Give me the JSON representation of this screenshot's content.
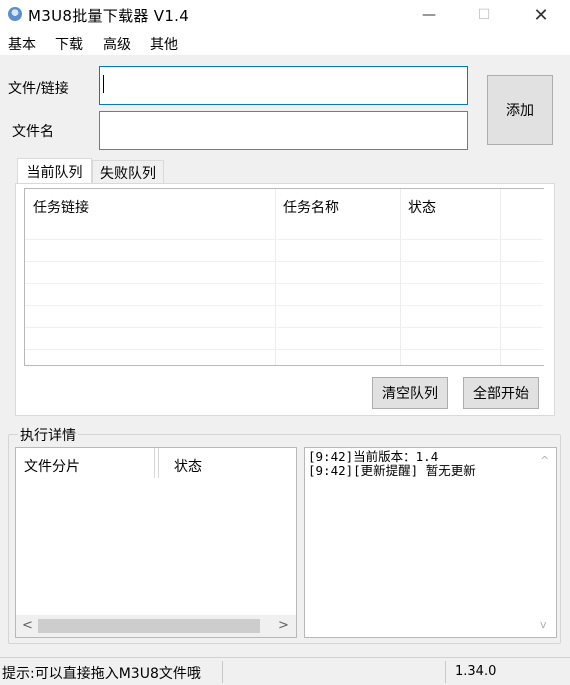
{
  "window": {
    "title": "M3U8批量下载器  V1.4",
    "minimize_glyph": "—",
    "maximize_glyph": "☐",
    "close_glyph": "✕"
  },
  "menu": {
    "items": [
      {
        "label": "基本"
      },
      {
        "label": "下载"
      },
      {
        "label": "高级"
      },
      {
        "label": "其他"
      }
    ]
  },
  "form": {
    "file_link_label": "文件/链接",
    "file_link_value": "",
    "file_name_label": "文件名",
    "file_name_value": "",
    "add_button": "添加"
  },
  "tabs": [
    {
      "label": "当前队列",
      "active": true
    },
    {
      "label": "失败队列",
      "active": false
    }
  ],
  "queue_table": {
    "columns": [
      "任务链接",
      "任务名称",
      "状态"
    ],
    "rows": []
  },
  "queue_actions": {
    "clear_button": "清空队列",
    "start_all_button": "全部开始"
  },
  "details": {
    "group_title": "执行详情",
    "columns": [
      "文件分片",
      "状态"
    ],
    "scroll_left": "<",
    "scroll_right": ">",
    "scroll_up": "^",
    "scroll_down": "v",
    "log_lines": [
      "[9:42]当前版本：1.4",
      "[9:42][更新提醒] 暂无更新"
    ]
  },
  "status": {
    "hint": "提示:可以直接拖入M3U8文件哦",
    "version": "1.34.0"
  },
  "colors": {
    "window_bg": "#f0f0f0",
    "focus_border": "#0078d7",
    "button_bg": "#e1e1e1"
  }
}
